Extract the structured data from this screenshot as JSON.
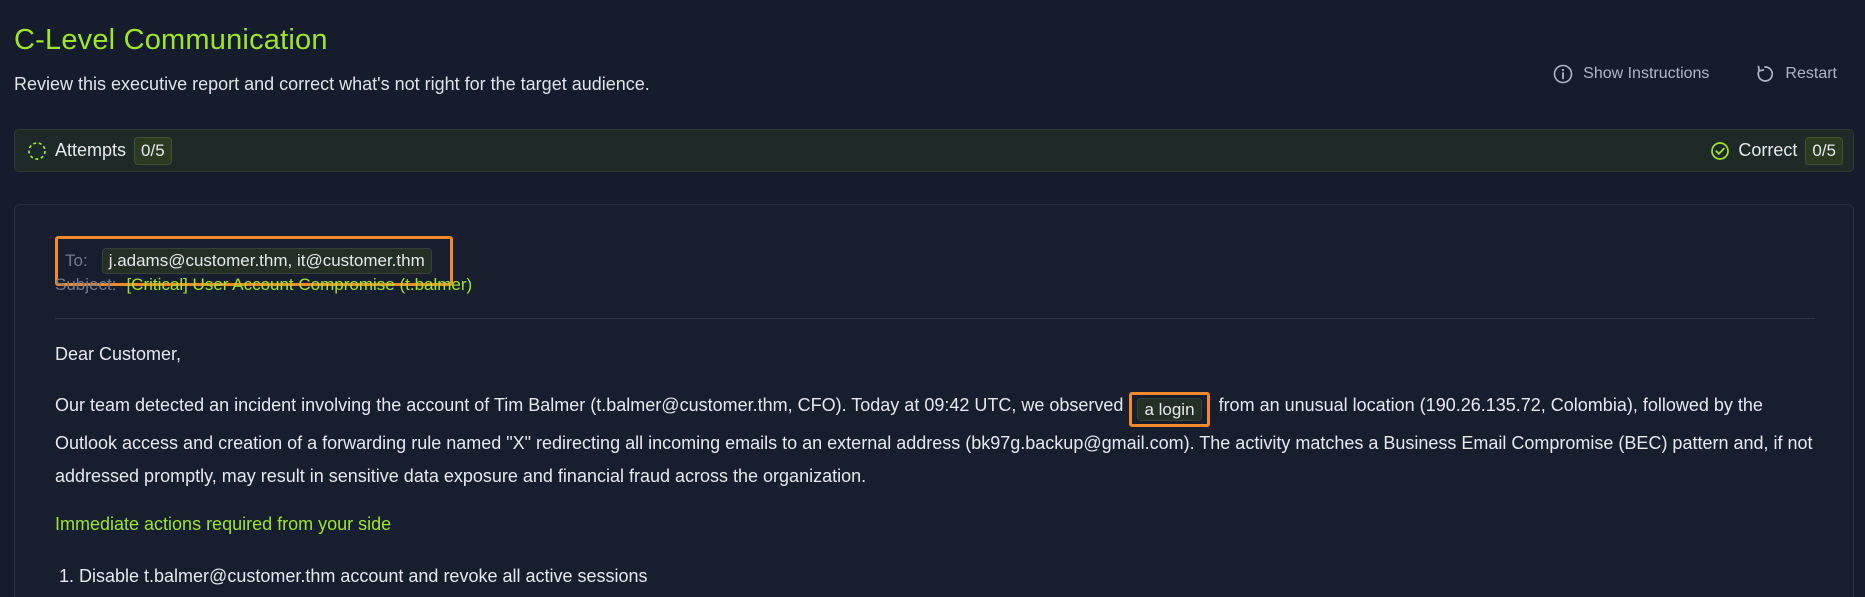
{
  "header": {
    "title": "C-Level Communication",
    "subtitle": "Review this executive report and correct what's not right for the target audience.",
    "show_instructions_label": "Show Instructions",
    "restart_label": "Restart"
  },
  "stats": {
    "attempts_label": "Attempts",
    "attempts_value": "0/5",
    "correct_label": "Correct",
    "correct_value": "0/5"
  },
  "email": {
    "to_label": "To:",
    "to_value": "j.adams@customer.thm, it@customer.thm",
    "subject_label": "Subject:",
    "subject_value": "[Critical] User Account Compromise (t.balmer)",
    "greeting": "Dear Customer,",
    "paragraph_before": "Our team detected an incident involving the account of Tim Balmer (t.balmer@customer.thm, CFO). Today at 09:42 UTC, we observed",
    "paragraph_highlight": "a login",
    "paragraph_after": "from an unusual location (190.26.135.72, Colombia), followed by the Outlook access and creation of a forwarding rule named \"X\" redirecting all incoming emails to an external address (bk97g.backup@gmail.com). The activity matches a Business Email Compromise (BEC) pattern and, if not addressed promptly, may result in sensitive data exposure and financial fraud across the organization.",
    "actions_heading": "Immediate actions required from your side",
    "actions": [
      "Disable t.balmer@customer.thm account and revoke all active sessions"
    ]
  },
  "colors": {
    "accent": "#9fe529",
    "highlight_border": "#f08a2b",
    "background": "#151c2b"
  },
  "icons": {
    "info": "info-icon",
    "restart": "restart-icon",
    "attempts": "dashed-circle-icon",
    "correct": "check-circle-icon"
  }
}
